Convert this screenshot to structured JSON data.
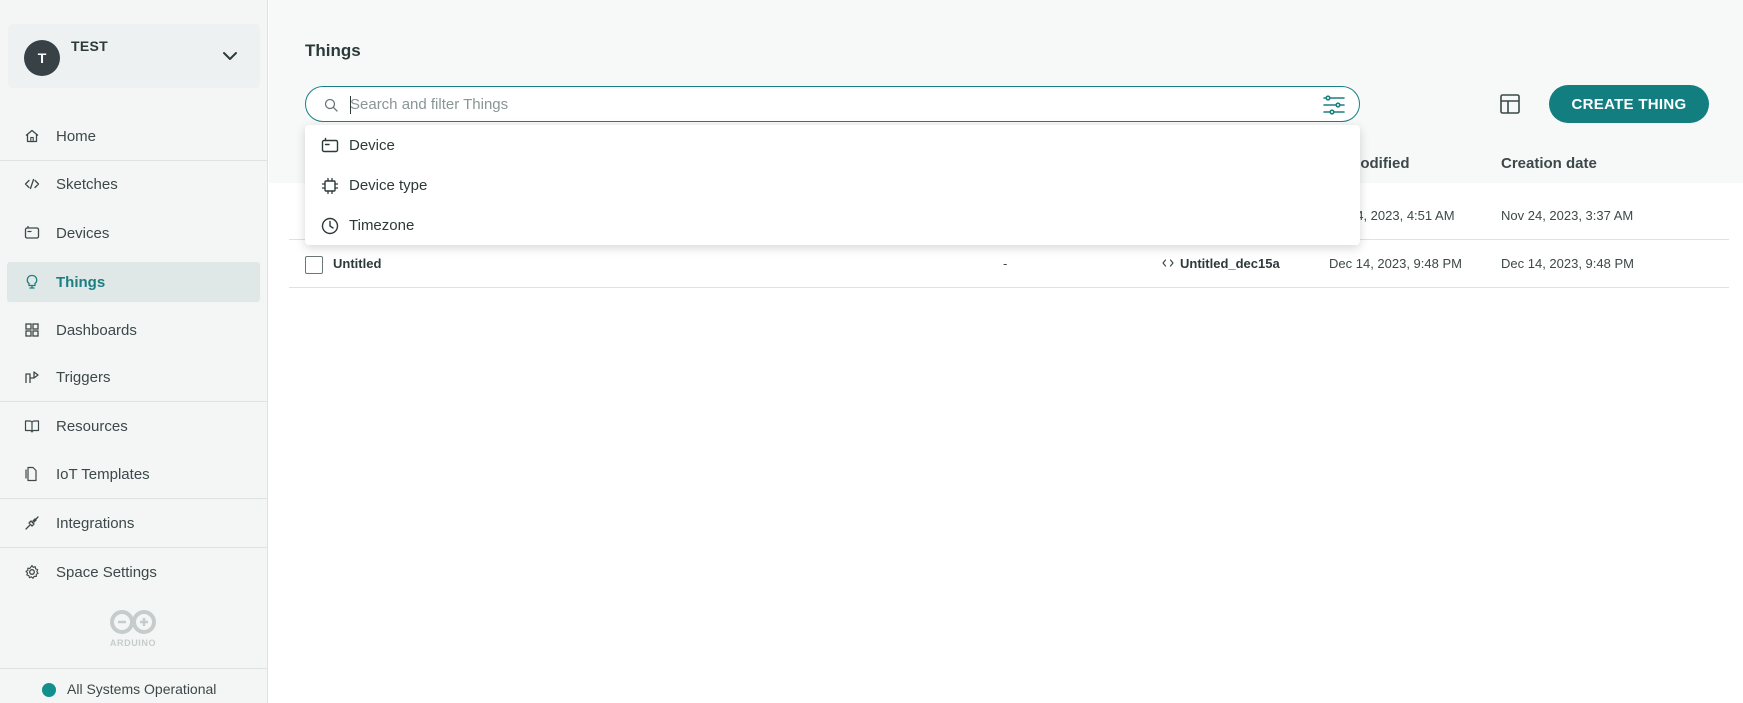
{
  "space": {
    "avatar_initial": "T",
    "name": "TEST"
  },
  "nav": {
    "items": [
      {
        "label": "Home"
      },
      {
        "label": "Sketches"
      },
      {
        "label": "Devices"
      },
      {
        "label": "Things"
      },
      {
        "label": "Dashboards"
      },
      {
        "label": "Triggers"
      },
      {
        "label": "Resources"
      },
      {
        "label": "IoT Templates"
      },
      {
        "label": "Integrations"
      },
      {
        "label": "Space Settings"
      }
    ],
    "active": "Things"
  },
  "brand": {
    "logo_text": "ARDUINO"
  },
  "status": {
    "label": "All Systems Operational",
    "color": "#13908e"
  },
  "page": {
    "title": "Things"
  },
  "search": {
    "placeholder": "Search and filter Things",
    "value": ""
  },
  "toolbar": {
    "create_label": "CREATE THING"
  },
  "table": {
    "columns": {
      "last_modified": "modified",
      "creation_date": "Creation date"
    },
    "rows": [
      {
        "name": "",
        "device": "",
        "sketch": "",
        "last_modified": "24, 2023, 4:51 AM",
        "creation_date": "Nov 24, 2023, 3:37 AM"
      },
      {
        "name": "Untitled",
        "device": "-",
        "sketch": "Untitled_dec15a",
        "last_modified": "Dec 14, 2023, 9:48 PM",
        "creation_date": "Dec 14, 2023, 9:48 PM"
      }
    ]
  },
  "filter_dropdown": {
    "items": [
      {
        "label": "Device",
        "icon": "device-icon"
      },
      {
        "label": "Device type",
        "icon": "chip-icon"
      },
      {
        "label": "Timezone",
        "icon": "clock-icon"
      }
    ]
  },
  "colors": {
    "accent": "#137e80",
    "accent_text": "#1b7f82",
    "sidebar_bg": "#f4f6f6",
    "active_bg": "#dfe7e7"
  }
}
